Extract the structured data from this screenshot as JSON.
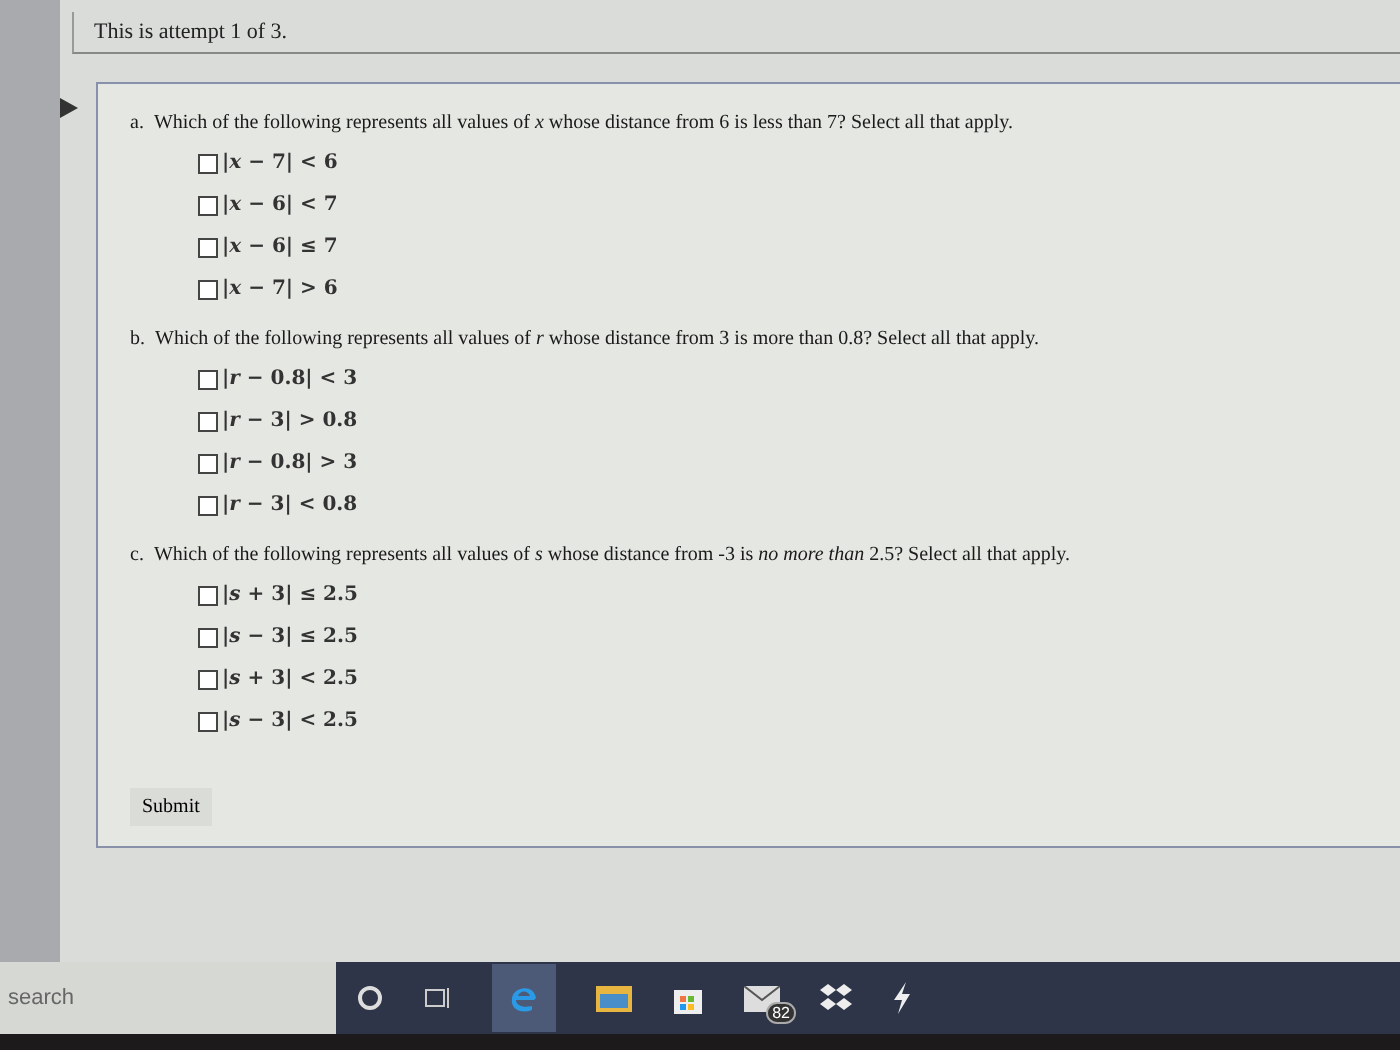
{
  "attempt": "This is attempt 1 of 3.",
  "questions": [
    {
      "label": "a.",
      "text": "Which of the following represents all values of *x* whose distance from 6 is less than 7? Select all that apply.",
      "options": [
        {
          "text": "|*x* − 7| < 6",
          "checked": false
        },
        {
          "text": "|*x* − 6| < 7",
          "checked": false
        },
        {
          "text": "|*x* − 6| ≤ 7",
          "checked": false
        },
        {
          "text": "|*x* − 7| > 6",
          "checked": false
        }
      ]
    },
    {
      "label": "b.",
      "text": "Which of the following represents all values of *r* whose distance from 3 is more than 0.8? Select all that apply.",
      "options": [
        {
          "text": "|*r* − 0.8| < 3",
          "checked": false
        },
        {
          "text": "|*r* − 3| > 0.8",
          "checked": false
        },
        {
          "text": "|*r* − 0.8| > 3",
          "checked": false
        },
        {
          "text": "|*r* − 3| < 0.8",
          "checked": false
        }
      ]
    },
    {
      "label": "c.",
      "text": "Which of the following represents all values of *s* whose distance from -3 is *no more than* 2.5? Select all that apply.",
      "options": [
        {
          "text": "|*s* + 3| ≤ 2.5",
          "checked": false
        },
        {
          "text": "|*s* − 3| ≤ 2.5",
          "checked": false
        },
        {
          "text": "|*s* + 3| < 2.5",
          "checked": false
        },
        {
          "text": "|*s* − 3| < 2.5",
          "checked": false
        }
      ]
    }
  ],
  "submit": "Submit",
  "taskbar": {
    "search": {
      "placeholder": "search"
    },
    "mail_badge": "82"
  }
}
